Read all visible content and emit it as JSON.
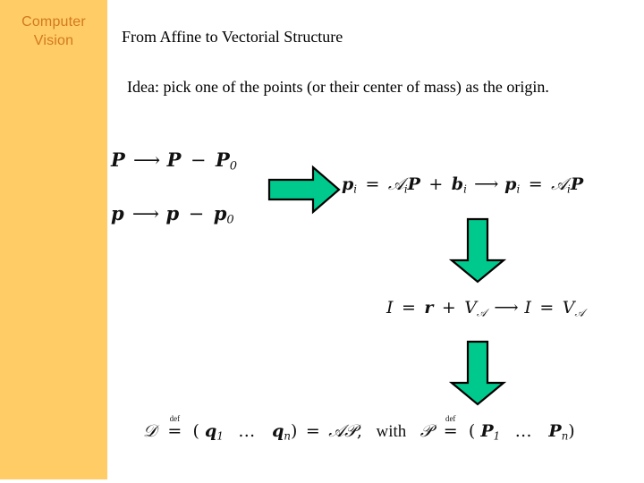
{
  "slide": {
    "sidebar": {
      "label": "Computer\nVision",
      "background_color": "#ffcc66",
      "text_color": "#d2791f"
    },
    "title": "From Affine to Vectorial Structure",
    "body": "Idea: pick one of the points (or their center of mass) as the origin.",
    "equations": {
      "point_map": {
        "lhs": "P",
        "arrow": "⟶",
        "rhs_base": "P",
        "rhs_op": "−",
        "rhs_term": "P",
        "rhs_sub": "0"
      },
      "vector_map": {
        "lhs": "p",
        "arrow": "⟶",
        "rhs_base": "p",
        "rhs_op": "−",
        "rhs_term": "p",
        "rhs_sub": "0"
      },
      "affine_to_linear": {
        "lhs_var": "p",
        "lhs_sub": "i",
        "eq": "=",
        "mat": "𝒜",
        "mat_sub": "i",
        "point": "P",
        "plus": "+",
        "b": "b",
        "b_sub": "i",
        "arrow": "⟶",
        "rhs_var": "p",
        "rhs_sub": "i",
        "rhs_eq": "=",
        "rhs_mat": "𝒜",
        "rhs_mat_sub": "i",
        "rhs_point": "P"
      },
      "image_space": {
        "lhs": "I",
        "eq": "=",
        "r": "r",
        "plus": "+",
        "V": "V",
        "V_sub": "𝒜",
        "arrow": "⟶",
        "rhs_lhs": "I",
        "rhs_eq": "=",
        "rhs_V": "V",
        "rhs_V_sub": "𝒜"
      },
      "data_matrix": {
        "D": "𝒟",
        "def": "def",
        "eq": "=",
        "open": "(",
        "q1": "q",
        "q1_sub": "1",
        "dots": "…",
        "qn": "q",
        "qn_sub": "n",
        "close": ")",
        "equals": "=",
        "A": "𝒜",
        "P_script": "𝒫",
        "comma": ",",
        "with": "with",
        "P2_script": "𝒫",
        "def2": "def",
        "eq2": "=",
        "open2": "(",
        "P1": "P",
        "P1_sub": "1",
        "dots2": "…",
        "Pn": "P",
        "Pn_sub": "n",
        "close2": ")"
      }
    },
    "arrows": {
      "fill_color": "#00c98e",
      "stroke_color": "#000000",
      "right_arrow": "arrow-right",
      "down_arrow_1": "arrow-down",
      "down_arrow_2": "arrow-down"
    }
  }
}
